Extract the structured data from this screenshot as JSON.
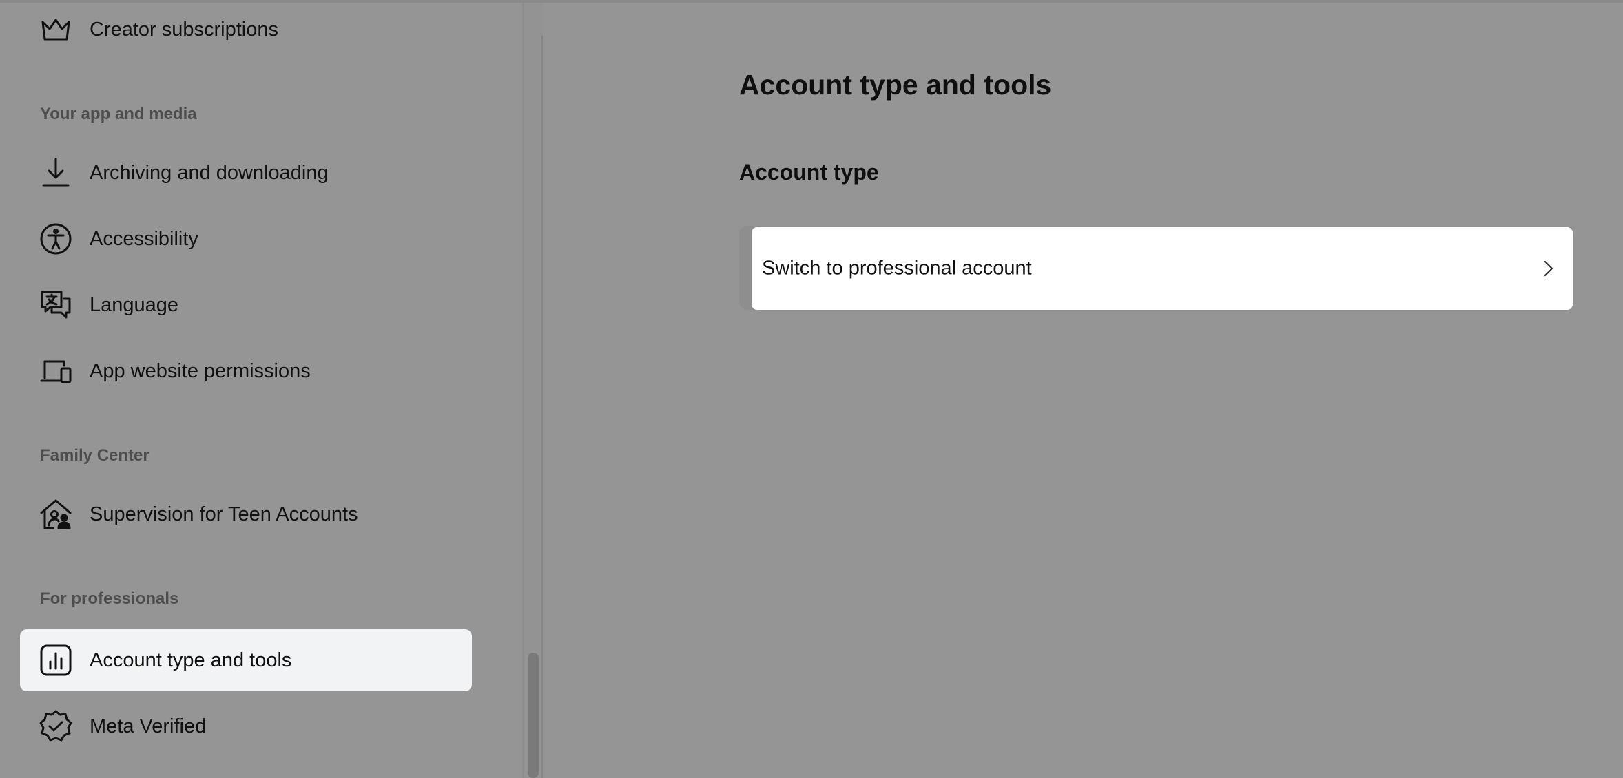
{
  "sidebar": {
    "top_item": {
      "label": "Creator subscriptions",
      "icon": "crown-icon"
    },
    "sections": [
      {
        "header": "Your app and media",
        "items": [
          {
            "label": "Archiving and downloading",
            "icon": "download-icon"
          },
          {
            "label": "Accessibility",
            "icon": "accessibility-icon"
          },
          {
            "label": "Language",
            "icon": "language-icon"
          },
          {
            "label": "App website permissions",
            "icon": "devices-icon"
          }
        ]
      },
      {
        "header": "Family Center",
        "items": [
          {
            "label": "Supervision for Teen Accounts",
            "icon": "family-home-icon"
          }
        ]
      },
      {
        "header": "For professionals",
        "items": [
          {
            "label": "Account type and tools",
            "icon": "bar-chart-icon",
            "active": true
          },
          {
            "label": "Meta Verified",
            "icon": "verified-badge-icon"
          }
        ]
      }
    ]
  },
  "main": {
    "title": "Account type and tools",
    "section_title": "Account type",
    "option": {
      "label": "Switch to professional account",
      "icon": "chevron-right-icon"
    }
  },
  "colors": {
    "overlay_background": "#959595",
    "active_item_background": "#f2f3f5",
    "card_background": "#ffffff",
    "section_header_text": "#4d4d4d"
  }
}
